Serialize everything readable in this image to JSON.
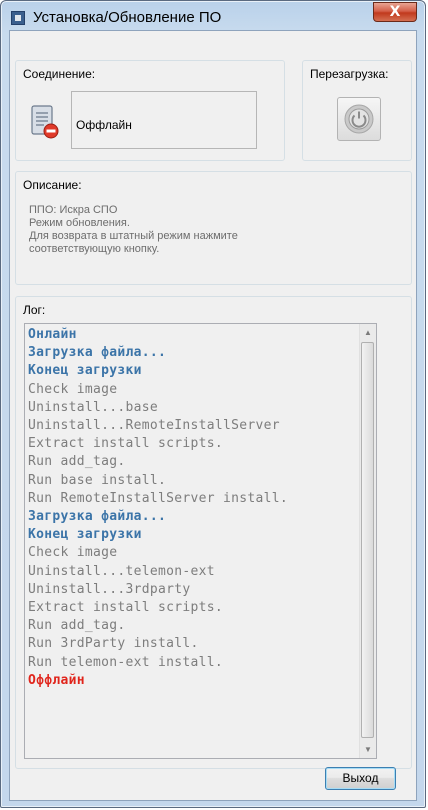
{
  "window": {
    "title": "Установка/Обновление ПО",
    "close_label": "X"
  },
  "connection": {
    "group_label": "Соединение:",
    "status_text": "Оффлайн",
    "icon": "server-offline-icon"
  },
  "reboot": {
    "group_label": "Перезагрузка:",
    "icon": "power-icon"
  },
  "description": {
    "group_label": "Описание:",
    "lines": [
      "ППО: Искра СПО",
      "Режим обновления.",
      "Для возврата в штатный режим нажмите",
      "соответствующую кнопку."
    ]
  },
  "log": {
    "group_label": "Лог:",
    "lines": [
      {
        "text": "Онлайн",
        "style": "blue"
      },
      {
        "text": "Загрузка файла...",
        "style": "blue"
      },
      {
        "text": "Конец загрузки",
        "style": "blue"
      },
      {
        "text": "Check image",
        "style": "gray"
      },
      {
        "text": "Uninstall...base",
        "style": "gray"
      },
      {
        "text": "Uninstall...RemoteInstallServer",
        "style": "gray"
      },
      {
        "text": "Extract install scripts.",
        "style": "gray"
      },
      {
        "text": "Run add_tag.",
        "style": "gray"
      },
      {
        "text": "Run base install.",
        "style": "gray"
      },
      {
        "text": "Run RemoteInstallServer install.",
        "style": "gray"
      },
      {
        "text": "Загрузка файла...",
        "style": "blue"
      },
      {
        "text": "Конец загрузки",
        "style": "blue"
      },
      {
        "text": "Check image",
        "style": "gray"
      },
      {
        "text": "Uninstall...telemon-ext",
        "style": "gray"
      },
      {
        "text": "Uninstall...3rdparty",
        "style": "gray"
      },
      {
        "text": "Extract install scripts.",
        "style": "gray"
      },
      {
        "text": "Run add_tag.",
        "style": "gray"
      },
      {
        "text": "Run 3rdParty install.",
        "style": "gray"
      },
      {
        "text": "Run telemon-ext install.",
        "style": "gray"
      },
      {
        "text": "Оффлайн",
        "style": "red"
      }
    ]
  },
  "buttons": {
    "exit_label": "Выход"
  },
  "colors": {
    "log_blue": "#3b74a8",
    "log_gray": "#7d7d7d",
    "log_red": "#e0241b"
  }
}
